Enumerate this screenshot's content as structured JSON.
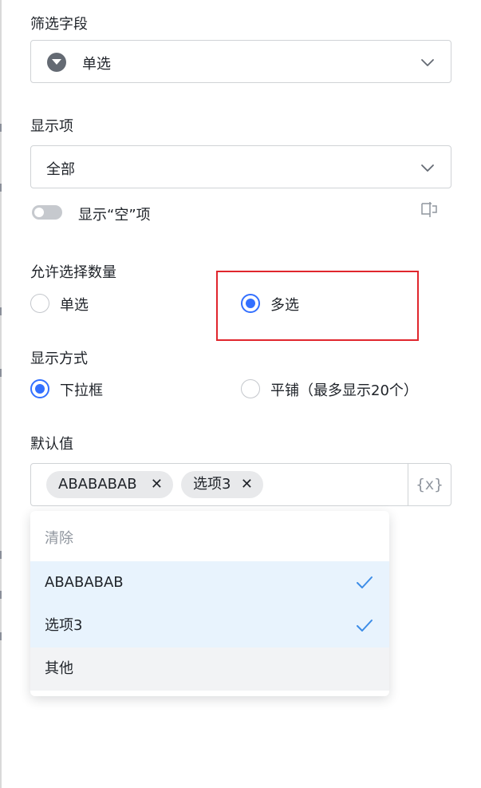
{
  "filter_field": {
    "label": "筛选字段",
    "value": "单选",
    "icon": "dropdown-circle-icon"
  },
  "display_items": {
    "label": "显示项",
    "value": "全部",
    "show_empty_label": "显示“空”项",
    "show_empty_enabled": false
  },
  "selection_count": {
    "label": "允许选择数量",
    "options": [
      "单选",
      "多选"
    ],
    "selected": "多选"
  },
  "display_mode": {
    "label": "显示方式",
    "options": [
      "下拉框",
      "平铺（最多显示20个）"
    ],
    "selected": "下拉框"
  },
  "default_value": {
    "label": "默认值",
    "tags": [
      "ABABABAB",
      "选项3"
    ],
    "tag_remove_glyph": "✕",
    "variable_button": "{x}"
  },
  "dropdown": {
    "clear_label": "清除",
    "items": [
      {
        "label": "ABABABAB",
        "selected": true
      },
      {
        "label": "选项3",
        "selected": true
      },
      {
        "label": "其他",
        "selected": false
      }
    ]
  },
  "colors": {
    "accent": "#3370ff",
    "highlight": "#e0262d",
    "selected_bg": "#e8f3fd",
    "check": "#3c8ce7"
  }
}
